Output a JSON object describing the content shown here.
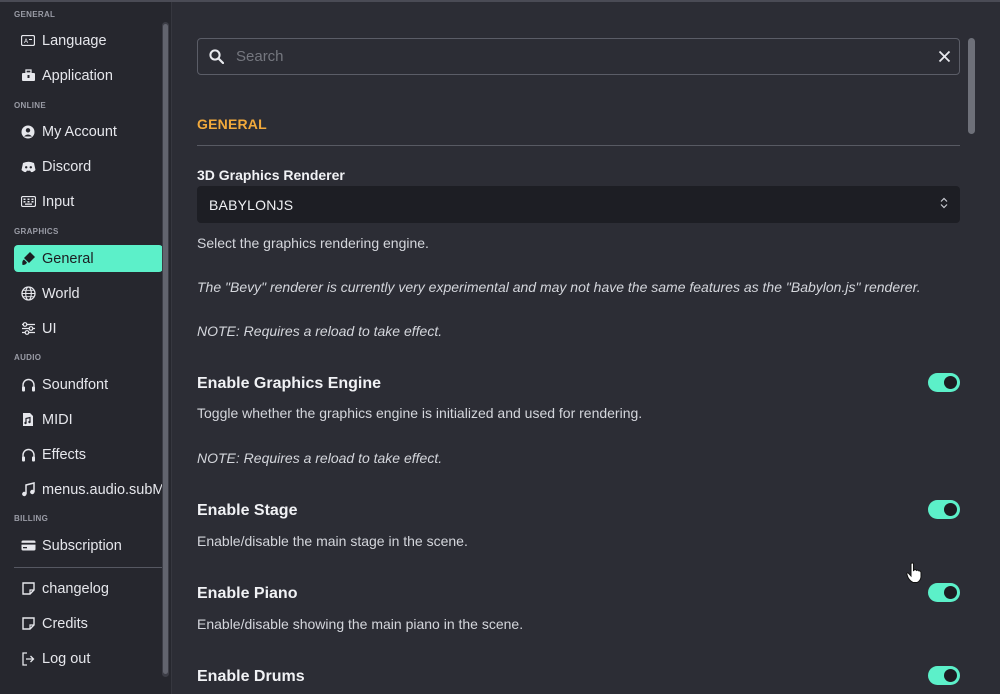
{
  "sidebar": {
    "sections": {
      "general": "GENERAL",
      "online": "ONLINE",
      "graphics": "GRAPHICS",
      "audio": "AUDIO",
      "billing": "BILLING"
    },
    "items": {
      "language": "Language",
      "application": "Application",
      "my_account": "My Account",
      "discord": "Discord",
      "input": "Input",
      "general": "General",
      "world": "World",
      "ui": "UI",
      "soundfont": "Soundfont",
      "midi": "MIDI",
      "effects": "Effects",
      "audio_sub": "menus.audio.subM",
      "subscription": "Subscription",
      "changelog": "changelog",
      "credits": "Credits",
      "logout": "Log out"
    },
    "active_item": "General"
  },
  "search": {
    "placeholder": "Search",
    "value": ""
  },
  "main": {
    "section_title": "GENERAL",
    "renderer": {
      "label": "3D Graphics Renderer",
      "value": "BABYLONJS",
      "desc": "Select the graphics rendering engine.",
      "note1": "The \"Bevy\" renderer is currently very experimental and may not have the same features as the \"Babylon.js\" renderer.",
      "note2": "NOTE: Requires a reload to take effect."
    },
    "graphics_engine": {
      "title": "Enable Graphics Engine",
      "desc": "Toggle whether the graphics engine is initialized and used for rendering.",
      "note": "NOTE: Requires a reload to take effect.",
      "enabled": true
    },
    "stage": {
      "title": "Enable Stage",
      "desc": "Enable/disable the main stage in the scene.",
      "enabled": true
    },
    "piano": {
      "title": "Enable Piano",
      "desc": "Enable/disable showing the main piano in the scene.",
      "enabled": true
    },
    "drums": {
      "title": "Enable Drums",
      "enabled": true
    }
  },
  "colors": {
    "accent": "#5cf0c9",
    "section_title": "#f2a93b",
    "background": "#2c2d35",
    "sidebar": "#26272e"
  }
}
